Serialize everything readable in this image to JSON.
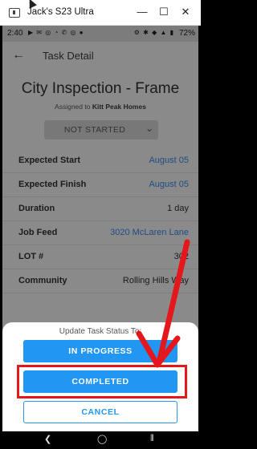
{
  "window": {
    "title": "Jack's S23 Ultra",
    "minimize_glyph": "—",
    "maximize_glyph": "☐",
    "close_glyph": "✕"
  },
  "status_bar": {
    "time": "2:40",
    "notification_icons": "▶ ✉ ◎ ◔ ✆ ◎ ●",
    "system_icons": "⚙ ✱ ◆ ▲ ▮",
    "battery": "72%"
  },
  "app_bar": {
    "back_glyph": "←",
    "title": "Task Detail"
  },
  "task": {
    "title": "City Inspection - Frame",
    "assigned_prefix": "Assigned to",
    "assigned_to": "Kitt Peak Homes",
    "status": "NOT STARTED",
    "status_chevron": "⌄"
  },
  "details": [
    {
      "label": "Expected Start",
      "value": "August 05",
      "link": true
    },
    {
      "label": "Expected Finish",
      "value": "August 05",
      "link": true
    },
    {
      "label": "Duration",
      "value": "1 day",
      "link": false
    },
    {
      "label": "Job Feed",
      "value": "3020 McLaren Lane",
      "link": true
    },
    {
      "label": "LOT #",
      "value": "302",
      "link": false
    },
    {
      "label": "Community",
      "value": "Rolling Hills Way",
      "link": false
    }
  ],
  "sheet": {
    "title": "Update Task Status To:",
    "in_progress_label": "IN PROGRESS",
    "completed_label": "COMPLETED",
    "cancel_label": "CANCEL"
  },
  "nav_bar": {
    "back_glyph": "❮",
    "home_glyph": "◯",
    "recent_glyph": "⦀"
  },
  "colors": {
    "primary": "#2196f3",
    "link": "#1f4c85",
    "annotation": "#e4171c"
  }
}
